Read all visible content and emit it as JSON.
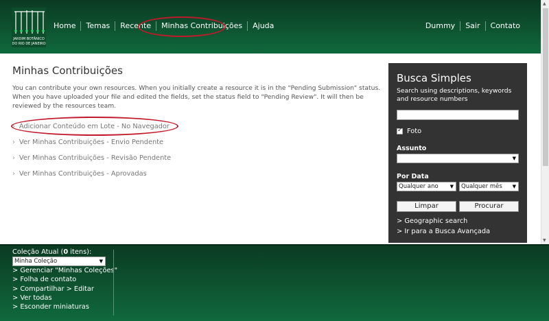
{
  "logo": {
    "text_lines": [
      "JARDIM BOTÂNICO",
      "DO RIO DE JANEIRO"
    ]
  },
  "topnav_left": [
    {
      "label": "Home"
    },
    {
      "label": "Temas"
    },
    {
      "label": "Recente"
    },
    {
      "label": "Minhas Contribuições"
    },
    {
      "label": "Ajuda"
    }
  ],
  "topnav_right": [
    {
      "label": "Dummy"
    },
    {
      "label": "Sair"
    },
    {
      "label": "Contato"
    }
  ],
  "main": {
    "title": "Minhas Contribuições",
    "intro": "You can contribute your own resources. When you initially create a resource it is in the \"Pending Submission\" status. When you have uploaded your file and edited the fields, set the status field to \"Pending Review\". It will then be reviewed by the resources team.",
    "links": [
      {
        "label": "Adicionar Conteúdo em Lote - No Navegador"
      },
      {
        "label": "Ver Minhas Contribuições - Envio Pendente"
      },
      {
        "label": "Ver Minhas Contribuições - Revisão Pendente"
      },
      {
        "label": "Ver Minhas Contribuições - Aprovadas"
      }
    ]
  },
  "search": {
    "title": "Busca Simples",
    "description": "Search using descriptions, keywords and resource numbers",
    "input_value": "",
    "photo_label": "Foto",
    "photo_checked": true,
    "subject_label": "Assunto",
    "subject_value": "",
    "date_label": "Por Data",
    "year_value": "Qualquer ano",
    "month_value": "Qualquer mês",
    "clear_label": "Limpar",
    "search_label": "Procurar",
    "geo_link": "> Geographic search",
    "advanced_link": "> Ir para a Busca Avançada"
  },
  "collection": {
    "title_prefix": "Coleção Atual (",
    "count": "0",
    "title_suffix": " itens):",
    "selected": "Minha Coleção",
    "links": [
      {
        "label": "> Gerenciar \"Minhas Coleções\""
      },
      {
        "label": "> Folha de contato"
      },
      {
        "label": "> Compartilhar  > Editar"
      },
      {
        "label": "> Ver todas"
      },
      {
        "label": "> Esconder miniaturas"
      }
    ]
  },
  "colors": {
    "header_dark": "#0b3a22",
    "header_light": "#10693d",
    "panel": "#333333",
    "highlight_ring": "#c2192a"
  }
}
